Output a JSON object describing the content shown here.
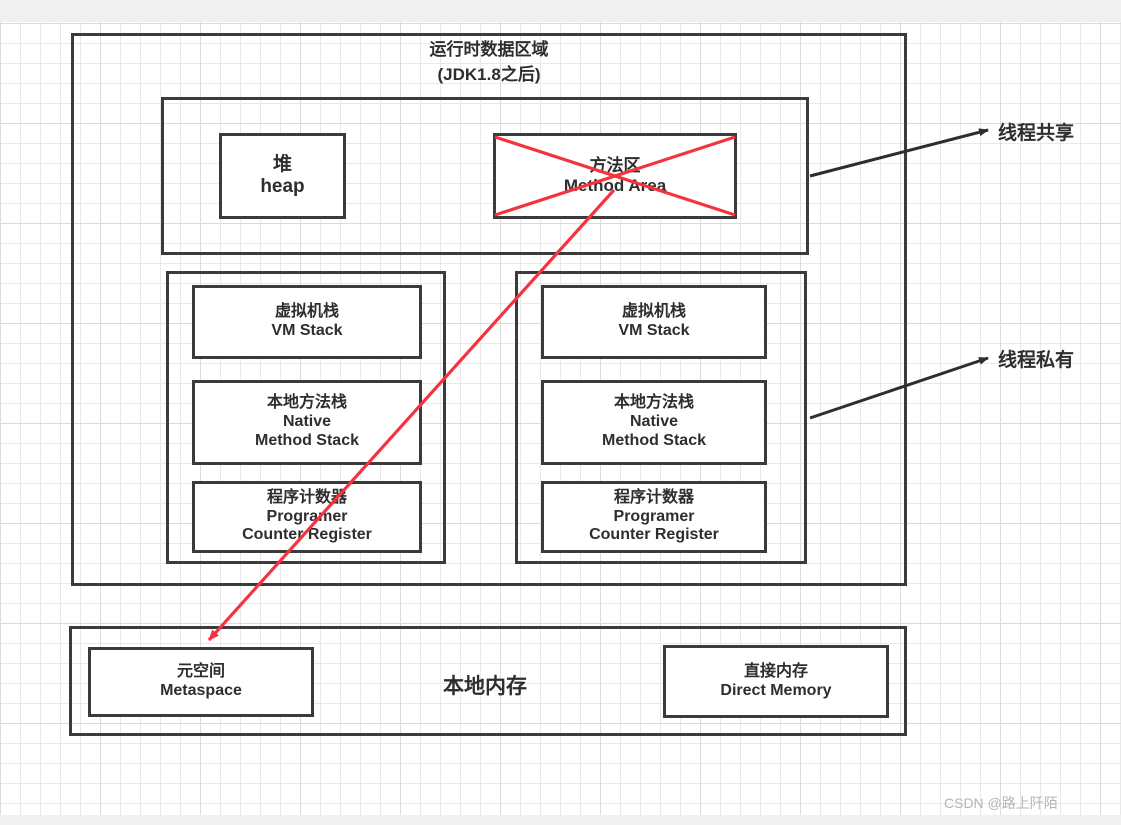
{
  "diagram": {
    "runtime_area": {
      "title_cn": "运行时数据区域",
      "title_en": "(JDK1.8之后)",
      "shared": {
        "heap": {
          "cn": "堆",
          "en": "heap"
        },
        "method_area": {
          "cn": "方法区",
          "en": "Method Area",
          "struck_out": true
        }
      },
      "private_threads": [
        {
          "items": [
            {
              "cn": "虚拟机栈",
              "en": "VM Stack"
            },
            {
              "cn": "本地方法栈",
              "en": "Native\nMethod Stack",
              "en_line1": "Native",
              "en_line2": "Method Stack"
            },
            {
              "cn": "程序计数器",
              "en_line1": "Programer",
              "en_line2": "Counter Register"
            }
          ]
        },
        {
          "items": [
            {
              "cn": "虚拟机栈",
              "en": "VM Stack"
            },
            {
              "cn": "本地方法栈",
              "en_line1": "Native",
              "en_line2": "Method Stack"
            },
            {
              "cn": "程序计数器",
              "en_line1": "Programer",
              "en_line2": "Counter Register"
            }
          ]
        }
      ]
    },
    "native_memory": {
      "title": "本地内存",
      "metaspace": {
        "cn": "元空间",
        "en": "Metaspace"
      },
      "direct_memory": {
        "cn": "直接内存",
        "en": "Direct Memory"
      }
    },
    "annotations": {
      "thread_shared": "线程共享",
      "thread_private": "线程私有"
    },
    "watermark": "CSDN @路上阡陌",
    "colors": {
      "stroke": "#3b3b3b",
      "text": "#2e2e2e",
      "strikeout": "#f5333f",
      "grid": "#e9e9e9",
      "background": "#f0f0f0"
    }
  }
}
